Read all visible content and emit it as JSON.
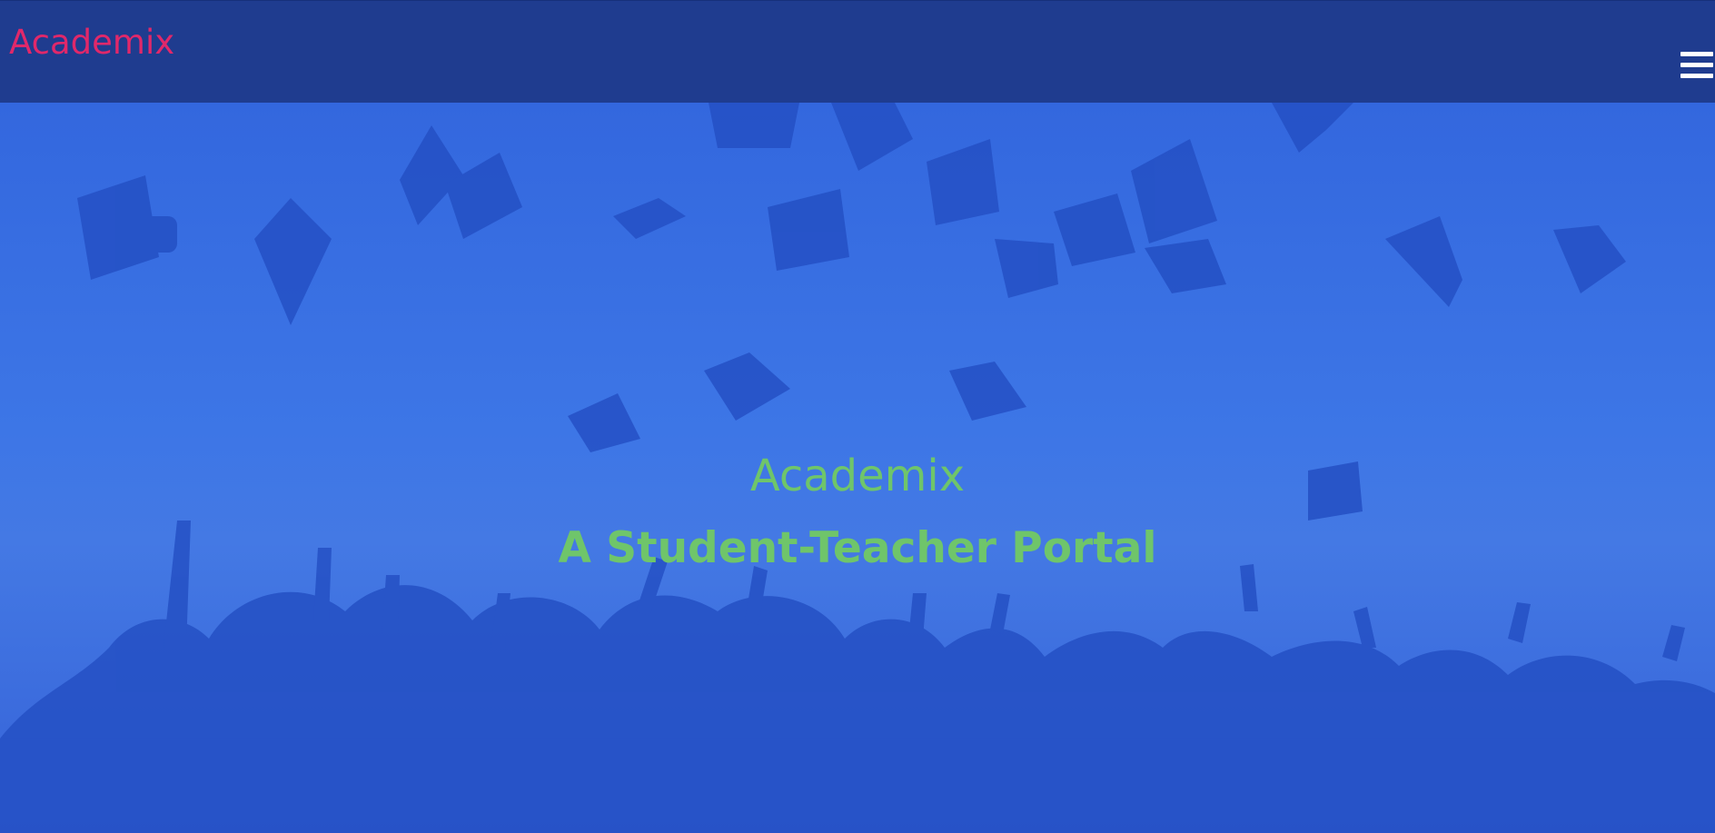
{
  "navbar": {
    "brand": "Academix",
    "menu_icon": "hamburger-menu-icon",
    "background_color": "#1f3c8f",
    "brand_color": "#e0286a"
  },
  "hero": {
    "title": "Academix",
    "subtitle": "A Student-Teacher Portal",
    "text_color": "#6fc56a",
    "overlay_color": "#3a6fe0",
    "background_image": "graduates-throwing-caps-photo"
  }
}
